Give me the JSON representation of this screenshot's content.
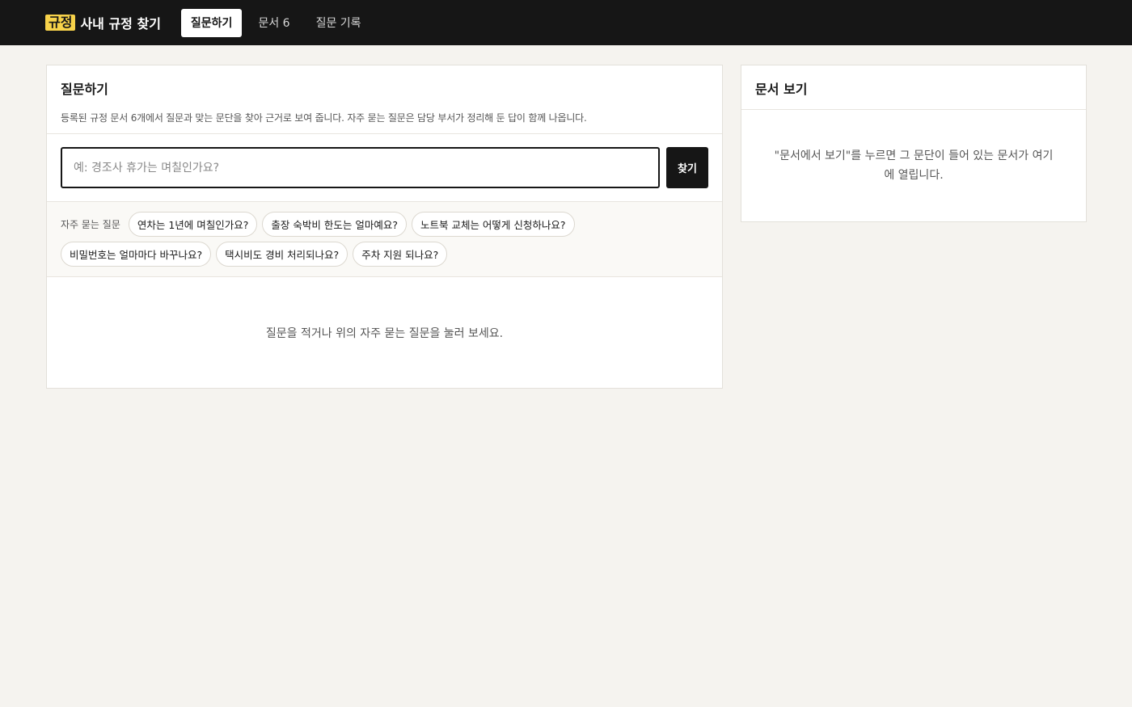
{
  "header": {
    "brand_badge": "규정",
    "brand_title": "사내 규정 찾기",
    "tabs": [
      {
        "label": "질문하기",
        "active": true
      },
      {
        "label": "문서 6",
        "active": false
      },
      {
        "label": "질문 기록",
        "active": false
      }
    ]
  },
  "ask_panel": {
    "title": "질문하기",
    "description": "등록된 규정 문서 6개에서 질문과 맞는 문단을 찾아 근거로 보여 줍니다. 자주 묻는 질문은 담당 부서가 정리해 둔 답이 함께 나옵니다.",
    "search": {
      "placeholder": "예: 경조사 휴가는 며칠인가요?",
      "value": "",
      "button_label": "찾기"
    },
    "faq": {
      "label": "자주 묻는 질문",
      "row1": [
        "연차는 1년에 며칠인가요?",
        "출장 숙박비 한도는 얼마예요?",
        "노트북 교체는 어떻게 신청하나요?"
      ],
      "row2": [
        "비밀번호는 얼마마다 바꾸나요?",
        "택시비도 경비 처리되나요?",
        "주차 지원 되나요?"
      ]
    },
    "empty_message": "질문을 적거나 위의 자주 묻는 질문을 눌러 보세요."
  },
  "doc_panel": {
    "title": "문서 보기",
    "empty_message": "\"문서에서 보기\"를 누르면 그 문단이 들어 있는 문서가 여기에 열립니다."
  },
  "colors": {
    "topbar": "#161616",
    "brand_badge": "#f7d24a",
    "background": "#f5f3ef"
  }
}
